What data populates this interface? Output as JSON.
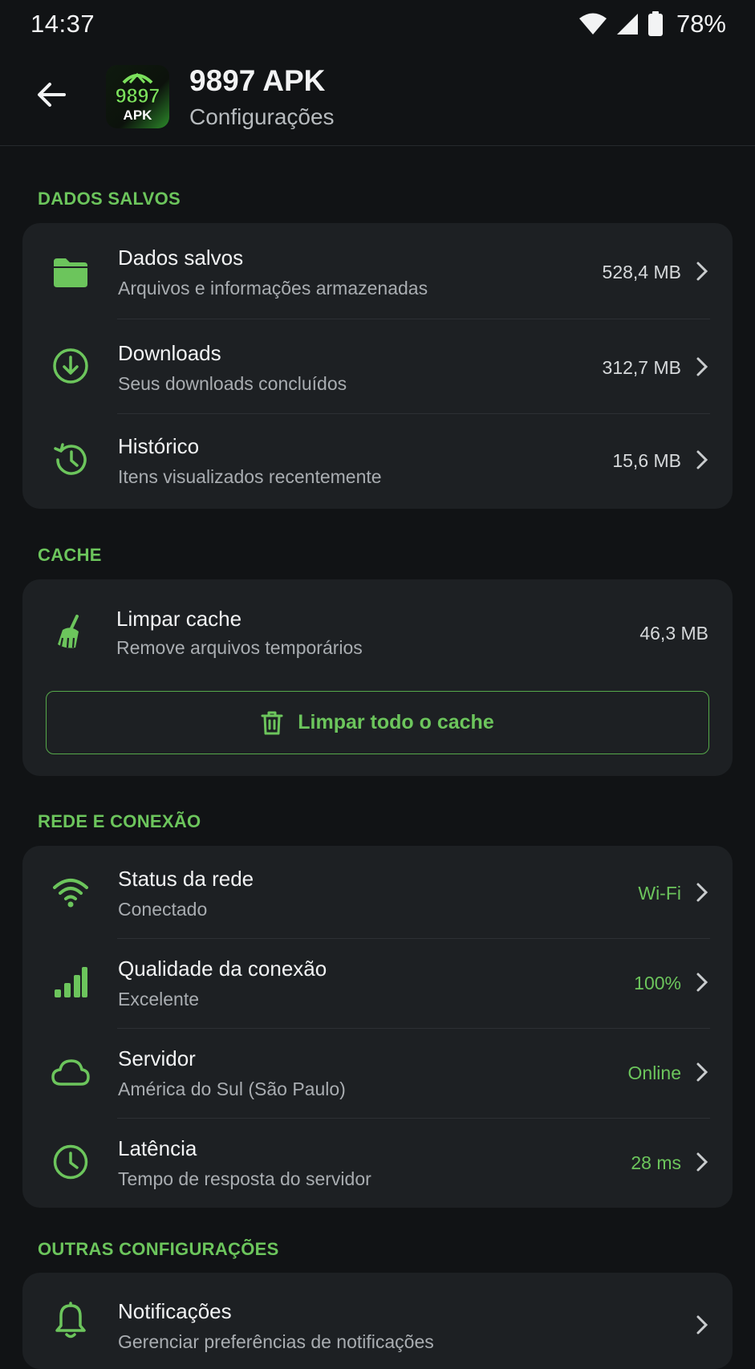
{
  "status_bar": {
    "time": "14:37",
    "battery": "78%"
  },
  "header": {
    "app_name": "9897 APK",
    "subtitle": "Configurações",
    "logo_text_top": "9897",
    "logo_text_bottom": "APK"
  },
  "sections": {
    "saved": {
      "title": "DADOS SALVOS",
      "items": [
        {
          "title": "Dados salvos",
          "subtitle": "Arquivos e informações armazenadas",
          "value": "528,4 MB",
          "icon": "folder-icon"
        },
        {
          "title": "Downloads",
          "subtitle": "Seus downloads concluídos",
          "value": "312,7 MB",
          "icon": "download-icon"
        },
        {
          "title": "Histórico",
          "subtitle": "Itens visualizados recentemente",
          "value": "15,6 MB",
          "icon": "history-icon"
        }
      ]
    },
    "cache": {
      "title": "CACHE",
      "item": {
        "title": "Limpar cache",
        "subtitle": "Remove arquivos temporários",
        "value": "46,3 MB",
        "icon": "broom-icon"
      },
      "button_label": "Limpar todo o cache"
    },
    "network": {
      "title": "REDE E CONEXÃO",
      "items": [
        {
          "title": "Status da rede",
          "subtitle": "Conectado",
          "value": "Wi-Fi",
          "icon": "wifi-icon"
        },
        {
          "title": "Qualidade da conexão",
          "subtitle": "Excelente",
          "value": "100%",
          "icon": "signal-bars-icon"
        },
        {
          "title": "Servidor",
          "subtitle": "América do Sul (São Paulo)",
          "value": "Online",
          "icon": "cloud-icon"
        },
        {
          "title": "Latência",
          "subtitle": "Tempo de resposta do servidor",
          "value": "28 ms",
          "icon": "clock-icon"
        }
      ]
    },
    "other": {
      "title": "OUTRAS CONFIGURAÇÕES",
      "items": [
        {
          "title": "Notificações",
          "subtitle": "Gerenciar preferências de notificações",
          "icon": "bell-icon"
        }
      ]
    }
  },
  "colors": {
    "accent": "#6cc55c",
    "background": "#111315",
    "card": "#1d2023"
  }
}
